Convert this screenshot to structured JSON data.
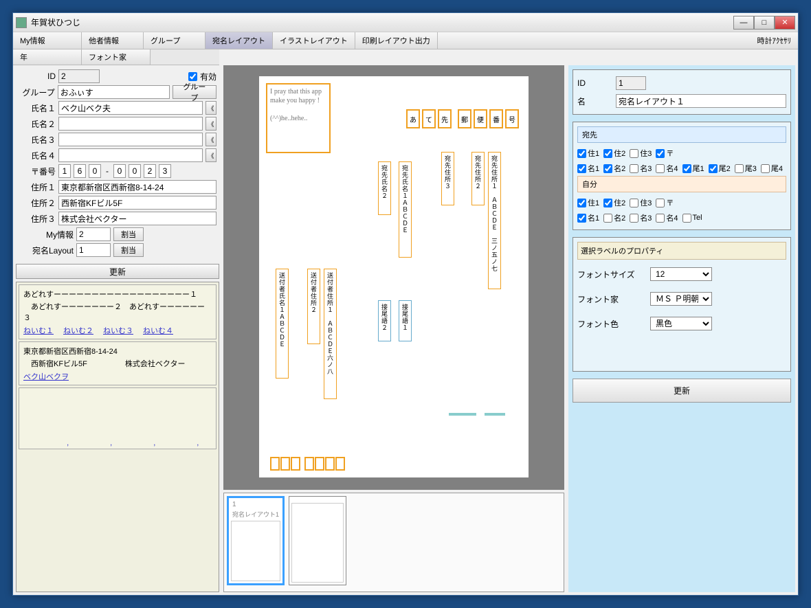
{
  "window": {
    "title": "年賀状ひつじ"
  },
  "tabs": {
    "my_info": "My情報",
    "other": "他者情報",
    "group": "グループ",
    "atena": "宛名レイアウト",
    "illust": "イラストレイアウト",
    "print": "印刷レイアウト出力",
    "clock": "時計ｱｸｾｻﾘ"
  },
  "subtabs": {
    "year": "年",
    "font": "フォント家"
  },
  "form": {
    "id_label": "ID",
    "id": "2",
    "valid_label": "有効",
    "valid": true,
    "group_label": "グループ",
    "group": "おふぃす",
    "group_btn": "グループ",
    "name1_label": "氏名１",
    "name1": "ベク山ベク夫",
    "name2_label": "氏名２",
    "name2": "",
    "name3_label": "氏名３",
    "name3": "",
    "name4_label": "氏名４",
    "name4": "",
    "postal_label": "〒番号",
    "postal": [
      "1",
      "6",
      "0",
      "0",
      "0",
      "2",
      "3"
    ],
    "addr1_label": "住所１",
    "addr1": "東京都新宿区西新宿8-14-24",
    "addr2_label": "住所２",
    "addr2": "西新宿KFビル5F",
    "addr3_label": "住所３",
    "addr3": "株式会社ベクター",
    "myinfo_label": "My情報",
    "myinfo": "2",
    "myinfo_btn": "割当",
    "atena_label": "宛名Layout",
    "atena": "1",
    "atena_btn": "割当",
    "update": "更新"
  },
  "cards": [
    {
      "lines": [
        "あどれすーーーーーーーーーーーーーーーーーー１",
        "　あどれすーーーーーーー２　あどれすーーーーーー３"
      ],
      "names": [
        "ねいむ１",
        "ねいむ２",
        "ねいむ３",
        "ねいむ４"
      ]
    },
    {
      "lines": [
        "東京都新宿区西新宿8-14-24",
        "　西新宿KFビル5F　　　　　株式会社ベクター"
      ],
      "names": [
        "ベク山ベクヲ"
      ]
    }
  ],
  "canvas": {
    "msg": "I pray that this app make you happy !\n\n(^^)he..hehe..",
    "stamps": [
      "あ",
      "て",
      "先",
      "郵",
      "便",
      "番",
      "号"
    ],
    "labels": {
      "atena_addr1": "宛先住所１　ＡＢＣＤＥ　三ノ五ノ七",
      "atena_addr2": "宛先住所２",
      "atena_addr3": "宛先住所３",
      "atena_name1": "宛先氏名１ＡＢＣＤＥ",
      "atena_name2": "宛先氏名２",
      "suffix1": "接尾語１",
      "suffix2": "接尾語２",
      "sender_addr1": "送付者住所１　ＡＢＣＤＥ六ノ八",
      "sender_addr2": "送付者住所２",
      "sender_name1": "送付者氏名１ＡＢＣＤＥ"
    }
  },
  "thumbs": [
    {
      "id": "1",
      "name": "宛名レイアウト1",
      "selected": true
    },
    {
      "id": "",
      "name": "",
      "selected": false
    }
  ],
  "rform": {
    "id_label": "ID",
    "id": "1",
    "name_label": "名",
    "name": "宛名レイアウト１",
    "atena_head": "宛先",
    "atena_checks1": [
      {
        "l": "住1",
        "c": true
      },
      {
        "l": "住2",
        "c": true
      },
      {
        "l": "住3",
        "c": false
      },
      {
        "l": "〒",
        "c": true
      }
    ],
    "atena_checks2": [
      {
        "l": "名1",
        "c": true
      },
      {
        "l": "名2",
        "c": true
      },
      {
        "l": "名3",
        "c": false
      },
      {
        "l": "名4",
        "c": false
      },
      {
        "l": "尾1",
        "c": true
      },
      {
        "l": "尾2",
        "c": true
      },
      {
        "l": "尾3",
        "c": false
      },
      {
        "l": "尾4",
        "c": false
      }
    ],
    "me_head": "自分",
    "me_checks1": [
      {
        "l": "住1",
        "c": true
      },
      {
        "l": "住2",
        "c": true
      },
      {
        "l": "住3",
        "c": false
      },
      {
        "l": "〒",
        "c": false
      }
    ],
    "me_checks2": [
      {
        "l": "名1",
        "c": true
      },
      {
        "l": "名2",
        "c": false
      },
      {
        "l": "名3",
        "c": false
      },
      {
        "l": "名4",
        "c": false
      },
      {
        "l": "Tel",
        "c": false
      }
    ],
    "prop_head": "選択ラベルのプロパティ",
    "fontsize_label": "フォントサイズ",
    "fontsize": "12",
    "fontfam_label": "フォント家",
    "fontfam": "ＭＳ Ｐ明朝",
    "fontcolor_label": "フォント色",
    "fontcolor": "黒色",
    "update": "更新"
  }
}
